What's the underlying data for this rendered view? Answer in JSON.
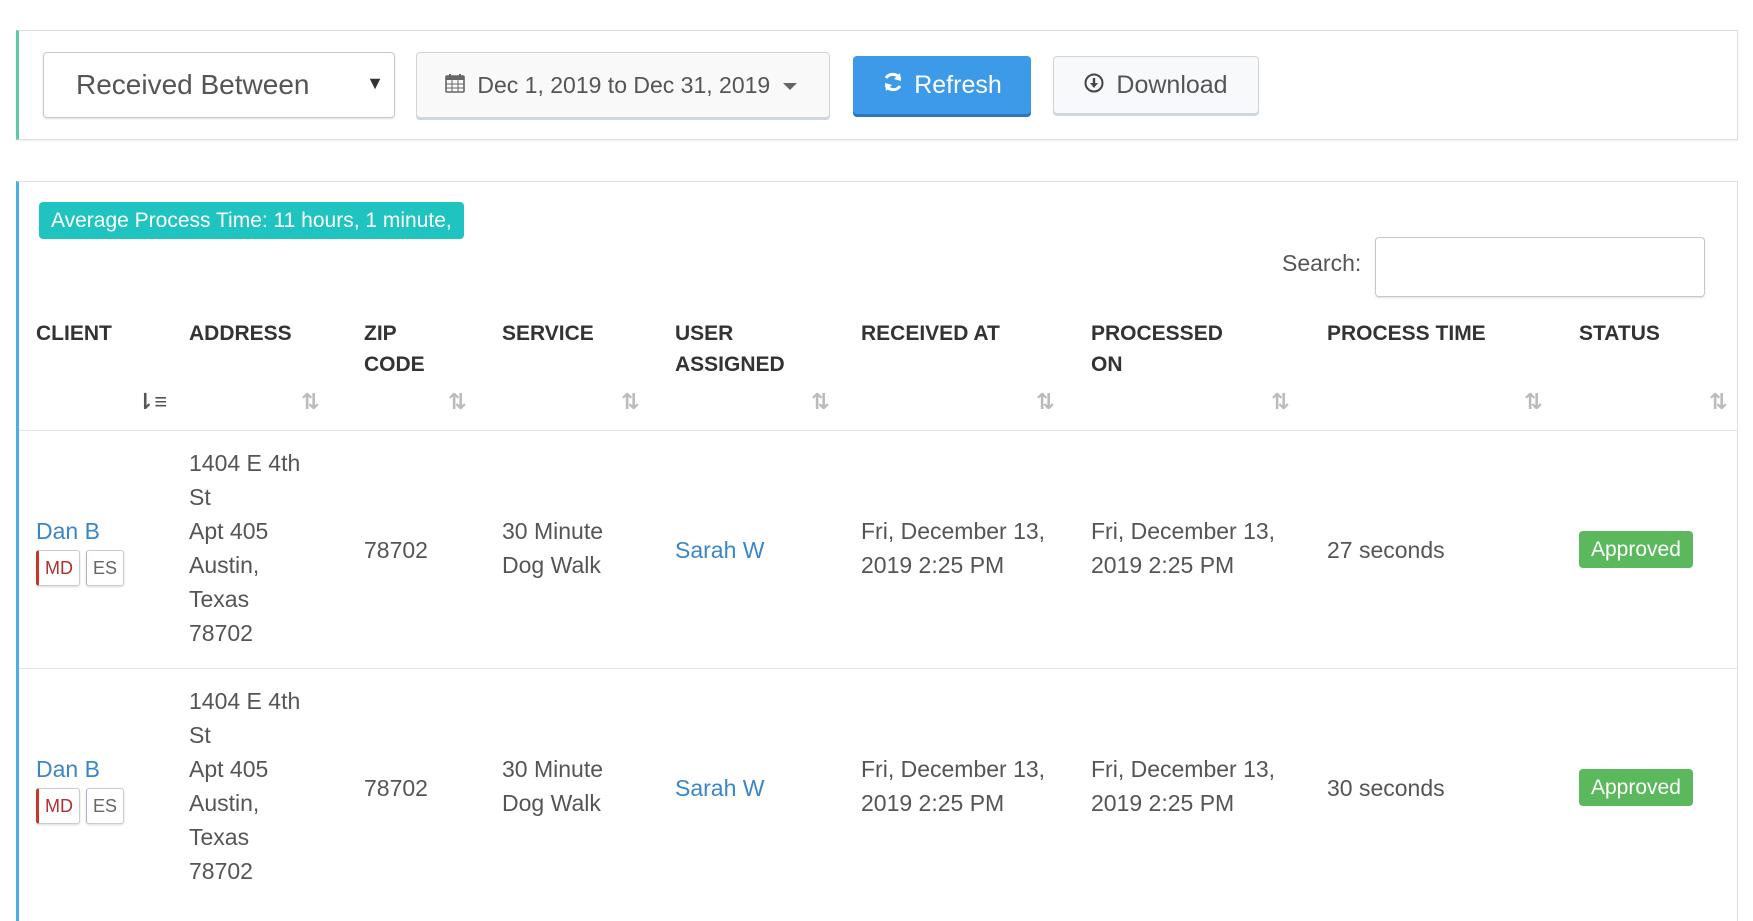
{
  "filters": {
    "date_type_selected": "Received Between",
    "date_range": "Dec 1, 2019 to Dec 31, 2019",
    "refresh_label": "Refresh",
    "download_label": "Download"
  },
  "summary": {
    "average_process_time": "Average Process Time: 11 hours, 1 minute,"
  },
  "search": {
    "label": "Search:",
    "value": ""
  },
  "table": {
    "headers": {
      "client": "Client",
      "address": "Address",
      "zip_code": "Zip Code",
      "service": "Service",
      "user_assigned": "User Assigned",
      "received_at": "Received At",
      "processed_on": "Processed On",
      "process_time": "Process Time",
      "status": "Status"
    },
    "rows": [
      {
        "client": "Dan B",
        "tags": [
          "MD",
          "ES"
        ],
        "address_lines": [
          "1404 E 4th",
          "St",
          "Apt 405",
          "Austin,",
          "Texas",
          "78702"
        ],
        "zip": "78702",
        "service_lines": [
          "30 Minute",
          "Dog Walk"
        ],
        "user_assigned": "Sarah W",
        "received_lines": [
          "Fri, December 13,",
          "2019 2:25 PM"
        ],
        "processed_lines": [
          "Fri, December 13,",
          "2019 2:25 PM"
        ],
        "process_time": "27 seconds",
        "status": "Approved"
      },
      {
        "client": "Dan B",
        "tags": [
          "MD",
          "ES"
        ],
        "address_lines": [
          "1404 E 4th",
          "St",
          "Apt 405",
          "Austin,",
          "Texas",
          "78702"
        ],
        "zip": "78702",
        "service_lines": [
          "30 Minute",
          "Dog Walk"
        ],
        "user_assigned": "Sarah W",
        "received_lines": [
          "Fri, December 13,",
          "2019 2:25 PM"
        ],
        "processed_lines": [
          "Fri, December 13,",
          "2019 2:25 PM"
        ],
        "process_time": "30 seconds",
        "status": "Approved"
      }
    ]
  },
  "colors": {
    "primary": "#3d9ae8",
    "link": "#3a86c8",
    "info_badge": "#1fc4c0",
    "success_badge": "#5cb85c"
  }
}
